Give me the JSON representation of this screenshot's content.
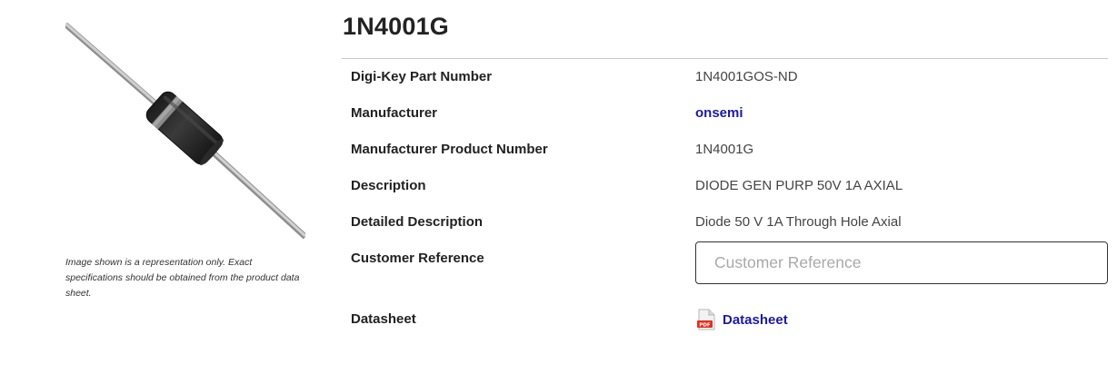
{
  "product": {
    "title": "1N4001G",
    "image_alt": "1N4001G axial diode",
    "image_disclaimer": "Image shown is a representation only. Exact specifications should be obtained from the product data sheet."
  },
  "attributes": [
    {
      "label": "Digi-Key Part Number",
      "value": "1N4001GOS-ND"
    },
    {
      "label": "Manufacturer",
      "value": "onsemi"
    },
    {
      "label": "Manufacturer Product Number",
      "value": "1N4001G"
    },
    {
      "label": "Description",
      "value": "DIODE GEN PURP 50V 1A AXIAL"
    },
    {
      "label": "Detailed Description",
      "value": "Diode 50 V 1A Through Hole Axial"
    },
    {
      "label": "Customer Reference",
      "value": "",
      "placeholder": "Customer Reference"
    },
    {
      "label": "Datasheet",
      "value": "Datasheet",
      "icon": "pdf-icon",
      "icon_text": "PDF"
    }
  ],
  "colors": {
    "link": "#1a1aa6",
    "pdf_red": "#e0301e",
    "rule": "#c8c8c8"
  }
}
